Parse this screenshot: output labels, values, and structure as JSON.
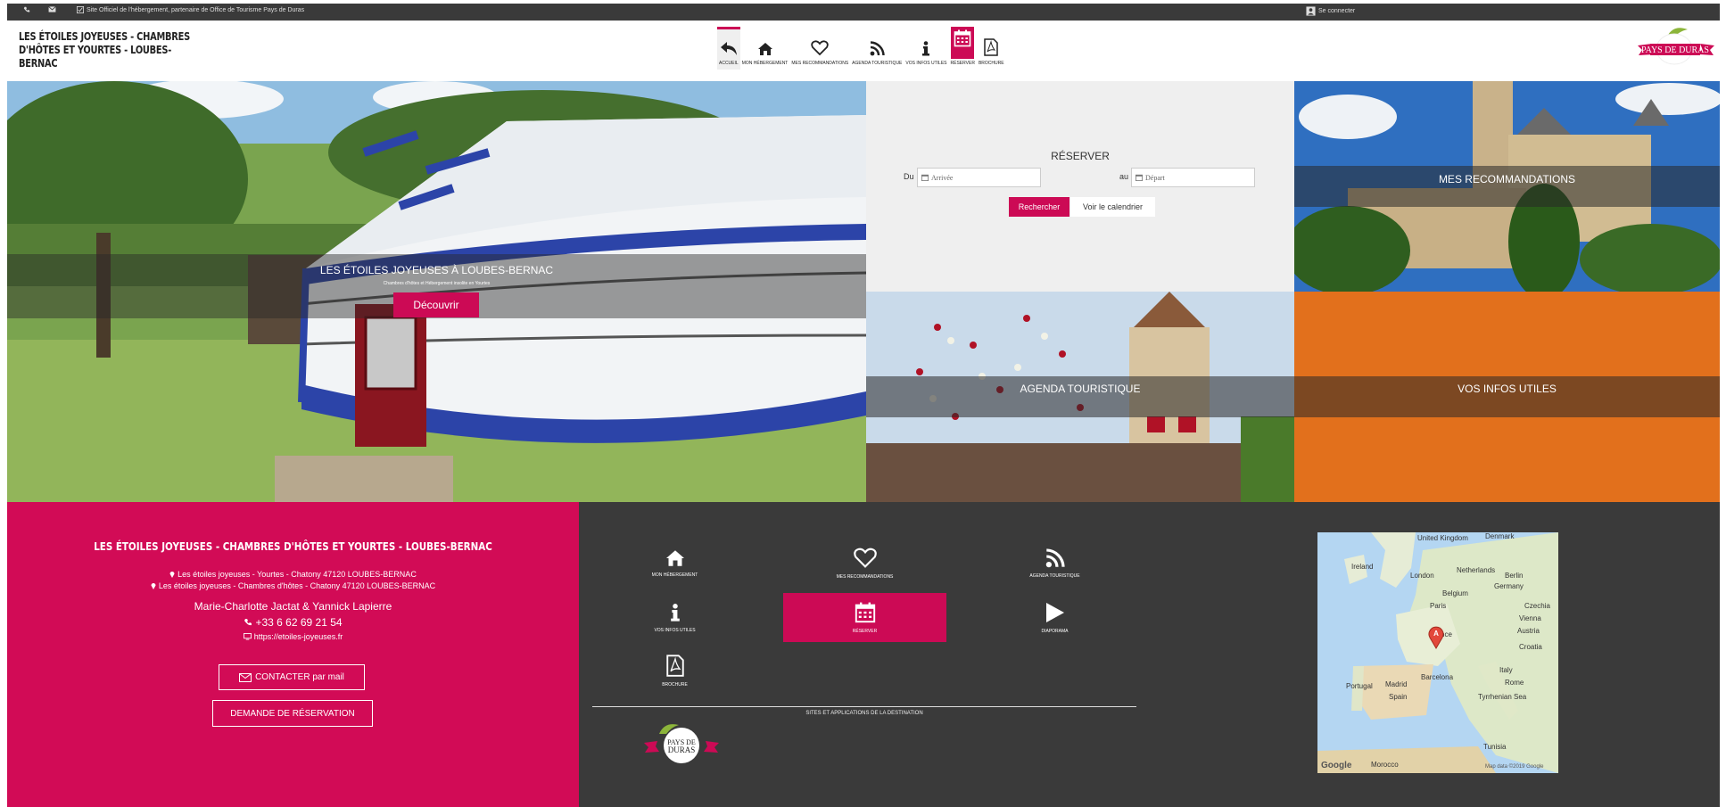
{
  "topbar": {
    "official_text": "Site Officiel de l'hébergement, partenaire de Office de Tourisme Pays de Duras",
    "login_label": "Se connecter"
  },
  "header": {
    "site_title": "Les Étoiles Joyeuses - Chambres d'hôtes et Yourtes - Loubes-Bernac",
    "logo_text": "PAYS DE DURAS"
  },
  "nav": [
    {
      "label": "ACCUEIL",
      "icon": "back-arrow-icon"
    },
    {
      "label": "MON HÉBERGEMENT",
      "icon": "home-icon"
    },
    {
      "label": "MES RECOMMANDATIONS",
      "icon": "heart-icon"
    },
    {
      "label": "AGENDA TOURISTIQUE",
      "icon": "rss-icon"
    },
    {
      "label": "VOS INFOS UTILES",
      "icon": "info-icon"
    },
    {
      "label": "RÉSERVER",
      "icon": "calendar-icon"
    },
    {
      "label": "BROCHURE",
      "icon": "pdf-icon"
    }
  ],
  "hero": {
    "title": "LES ÉTOILES JOYEUSES À LOUBES-BERNAC",
    "subtitle": "Chambres d'hôtes et Hébergement insolite en Yourtes",
    "button": "Découvrir"
  },
  "booking": {
    "title": "RÉSERVER",
    "from_label": "Du",
    "to_label": "au",
    "arrival_placeholder": "Arrivée",
    "departure_placeholder": "Départ",
    "search_button": "Rechercher",
    "calendar_button": "Voir le calendrier"
  },
  "tiles": {
    "recommandations": "MES RECOMMANDATIONS",
    "agenda": "AGENDA TOURISTIQUE",
    "infos": "VOS INFOS UTILES"
  },
  "footer_contact": {
    "title": "Les Étoiles Joyeuses - Chambres d'hôtes et Yourtes - Loubes-Bernac",
    "address1": "Les étoiles joyeuses - Yourtes - Chatony 47120 LOUBES-BERNAC",
    "address2": "Les étoiles joyeuses - Chambres d'hôtes - Chatony 47120 LOUBES-BERNAC",
    "owners": "Marie-Charlotte Jactat & Yannick Lapierre",
    "phone": "+33 6 62 69 21 54",
    "website": "https://etoiles-joyeuses.fr",
    "contact_button": "CONTACTER par mail",
    "booking_button": "DEMANDE DE RÉSERVATION"
  },
  "footer_nav": [
    {
      "label": "MON HÉBERGEMENT",
      "icon": "home-icon"
    },
    {
      "label": "MES RECOMMANDATIONS",
      "icon": "heart-icon"
    },
    {
      "label": "AGENDA TOURISTIQUE",
      "icon": "rss-icon"
    },
    {
      "label": "VOS INFOS UTILES",
      "icon": "info-icon"
    },
    {
      "label": "RÉSERVER",
      "icon": "calendar-icon"
    },
    {
      "label": "DIAPORAMA",
      "icon": "play-icon"
    },
    {
      "label": "BROCHURE",
      "icon": "pdf-icon"
    }
  ],
  "destination": {
    "label": "SITES ET APPLICATIONS DE LA DESTINATION",
    "logo_text": "PAYS DE DURAS"
  },
  "map": {
    "labels": [
      "United Kingdom",
      "Denmark",
      "Ireland",
      "London",
      "Netherlands",
      "Berlin",
      "Germany",
      "Belgium",
      "Paris",
      "Czechia",
      "Vienna",
      "Austria",
      "France",
      "Croatia",
      "Portugal",
      "Madrid",
      "Spain",
      "Barcelona",
      "Italy",
      "Rome",
      "Tyrrhenian Sea",
      "Tunisia",
      "Morocco"
    ],
    "marker": "A",
    "google": "Google",
    "data": "Map data ©2019 Google"
  },
  "colors": {
    "accent": "#cc0a55",
    "dark": "#3a3a3a",
    "orange": "#e2701c"
  }
}
